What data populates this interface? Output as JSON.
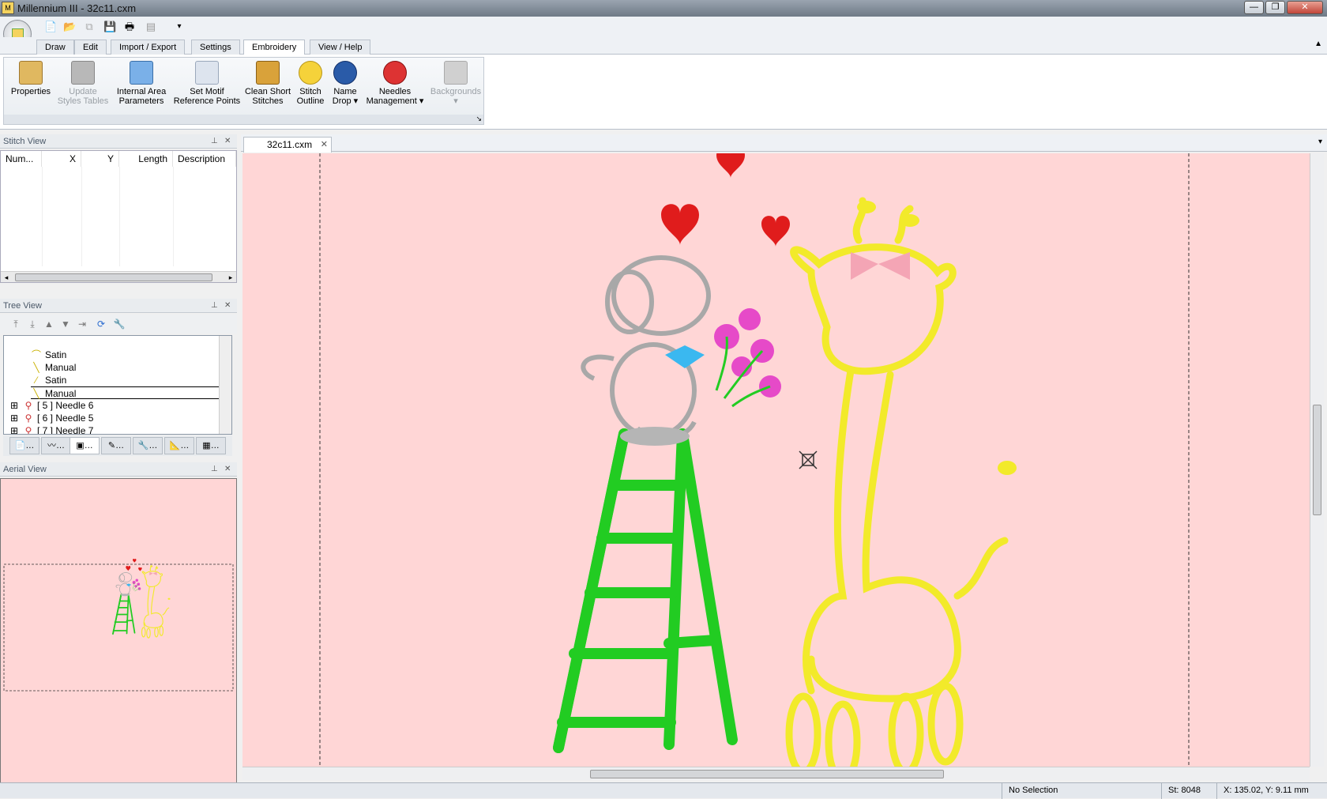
{
  "window": {
    "title": "Millennium III - 32c11.cxm",
    "min": "—",
    "max": "❐",
    "close": "✕"
  },
  "qat": {
    "items": [
      "new-icon",
      "open-icon",
      "copy-icon",
      "save-icon",
      "print-icon",
      "preview-icon",
      "customize-icon"
    ]
  },
  "ribbon": {
    "tabs": [
      "Draw",
      "Edit",
      "Import / Export",
      "Settings",
      "Embroidery",
      "View / Help"
    ],
    "active_tab": "Embroidery",
    "buttons": [
      {
        "line1": "Properties",
        "line2": "",
        "enabled": true,
        "icon": "properties-icon",
        "color": "#e0b860"
      },
      {
        "line1": "Update",
        "line2": "Styles Tables",
        "enabled": false,
        "icon": "styles-table-icon",
        "color": "#b8b8b8"
      },
      {
        "line1": "Internal Area",
        "line2": "Parameters",
        "enabled": true,
        "icon": "area-params-icon",
        "color": "#7ab0e8"
      },
      {
        "line1": "Set Motif",
        "line2": "Reference Points",
        "enabled": true,
        "icon": "motif-ref-icon",
        "color": "#c8d2e0"
      },
      {
        "line1": "Clean Short",
        "line2": "Stitches",
        "enabled": true,
        "icon": "broom-icon",
        "color": "#d9a23a"
      },
      {
        "line1": "Stitch",
        "line2": "Outline",
        "enabled": true,
        "icon": "bulb-icon",
        "color": "#f5d23a"
      },
      {
        "line1": "Name",
        "line2": "Drop ▾",
        "enabled": true,
        "icon": "name-drop-icon",
        "color": "#2a5ba8"
      },
      {
        "line1": "Needles",
        "line2": "Management ▾",
        "enabled": true,
        "icon": "needles-stop-icon",
        "color": "#d33"
      },
      {
        "line1": "Backgrounds",
        "line2": "▾",
        "enabled": false,
        "icon": "backgrounds-icon",
        "color": "#c8c8c8"
      }
    ]
  },
  "stitch_view": {
    "title": "Stitch View",
    "columns": [
      "Num...",
      "X",
      "Y",
      "Length",
      "Description"
    ]
  },
  "tree_view": {
    "title": "Tree View",
    "items": [
      {
        "label": "Satin",
        "indent": 2,
        "glyph": "satin-curve-icon",
        "selected": false
      },
      {
        "label": "Manual",
        "indent": 2,
        "glyph": "manual-line-icon",
        "selected": false
      },
      {
        "label": "Satin",
        "indent": 2,
        "glyph": "satin-hatch-icon",
        "selected": false
      },
      {
        "label": "Manual",
        "indent": 2,
        "glyph": "manual-line-icon",
        "selected": true
      },
      {
        "label": "[ 5 ] Needle 6",
        "indent": 0,
        "glyph": "needle-icon",
        "selected": false
      },
      {
        "label": "[ 6 ] Needle 5",
        "indent": 0,
        "glyph": "needle-icon",
        "selected": false
      },
      {
        "label": "[ 7 ] Needle 7",
        "indent": 0,
        "glyph": "needle-icon",
        "selected": false
      }
    ]
  },
  "aerial_view": {
    "title": "Aerial View"
  },
  "document": {
    "tab": "32c11.cxm"
  },
  "status": {
    "selection": "No Selection",
    "stitches": "St: 8048",
    "coords": "X: 135.02, Y: 9.11 mm"
  },
  "colors": {
    "canvas_bg": "#ffd6d6",
    "ladder": "#22cc22",
    "giraffe": "#f2ea2a",
    "hearts": "#e01c1c",
    "mouse": "#a8a8a8",
    "flowers": "#e64ac8",
    "bow_blue": "#3ab8f0"
  }
}
